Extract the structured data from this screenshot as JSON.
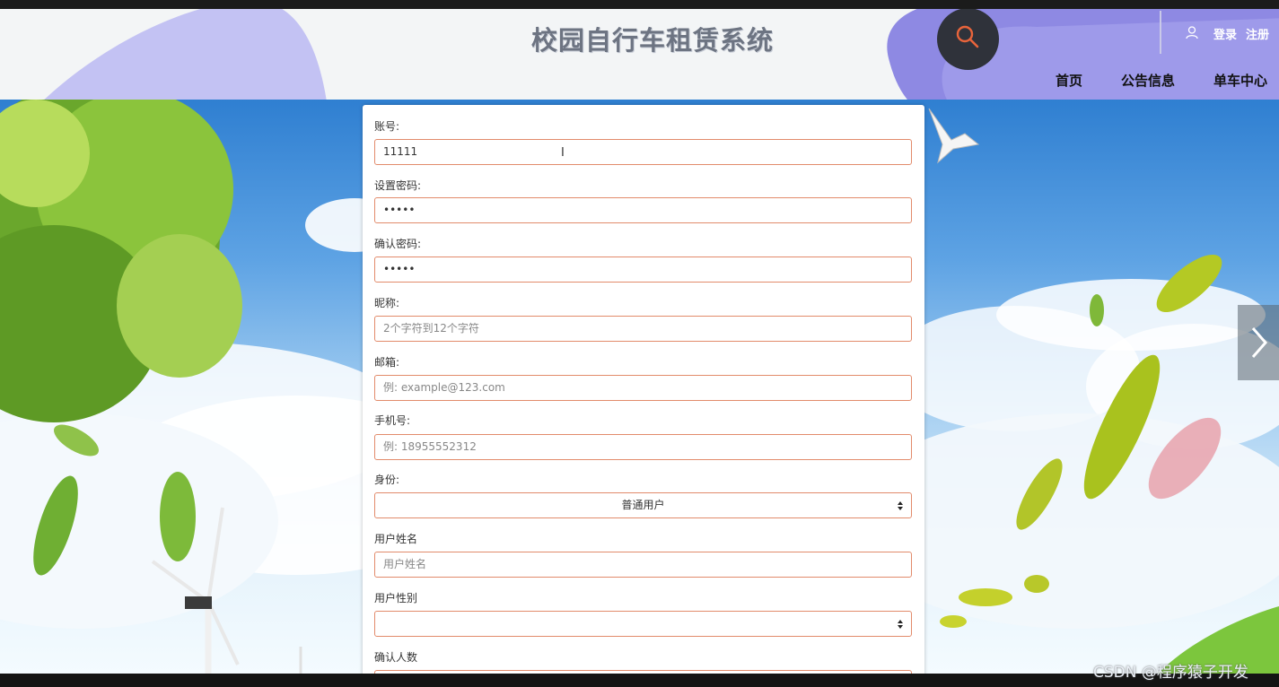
{
  "header": {
    "title": "校园自行车租赁系统",
    "login": "登录",
    "register": "注册",
    "nav": [
      "首页",
      "公告信息",
      "单车中心"
    ]
  },
  "form": {
    "account": {
      "label": "账号:",
      "value": "11111"
    },
    "password": {
      "label": "设置密码:",
      "value": "•••••"
    },
    "confirm_password": {
      "label": "确认密码:",
      "value": "•••••"
    },
    "nickname": {
      "label": "昵称:",
      "placeholder": "2个字符到12个字符"
    },
    "email": {
      "label": "邮箱:",
      "placeholder": "例: example@123.com"
    },
    "phone": {
      "label": "手机号:",
      "placeholder": "例: 18955552312"
    },
    "identity": {
      "label": "身份:",
      "selected": "普通用户"
    },
    "real_name": {
      "label": "用户姓名",
      "placeholder": "用户姓名"
    },
    "gender": {
      "label": "用户性别",
      "selected": ""
    },
    "confirm_count": {
      "label": "确认人数"
    }
  },
  "watermark": "CSDN @程序猿子开发",
  "colors": {
    "accent": "#e28b6b",
    "header_bg": "#f3f5f6",
    "blob": "#8b86e0"
  }
}
